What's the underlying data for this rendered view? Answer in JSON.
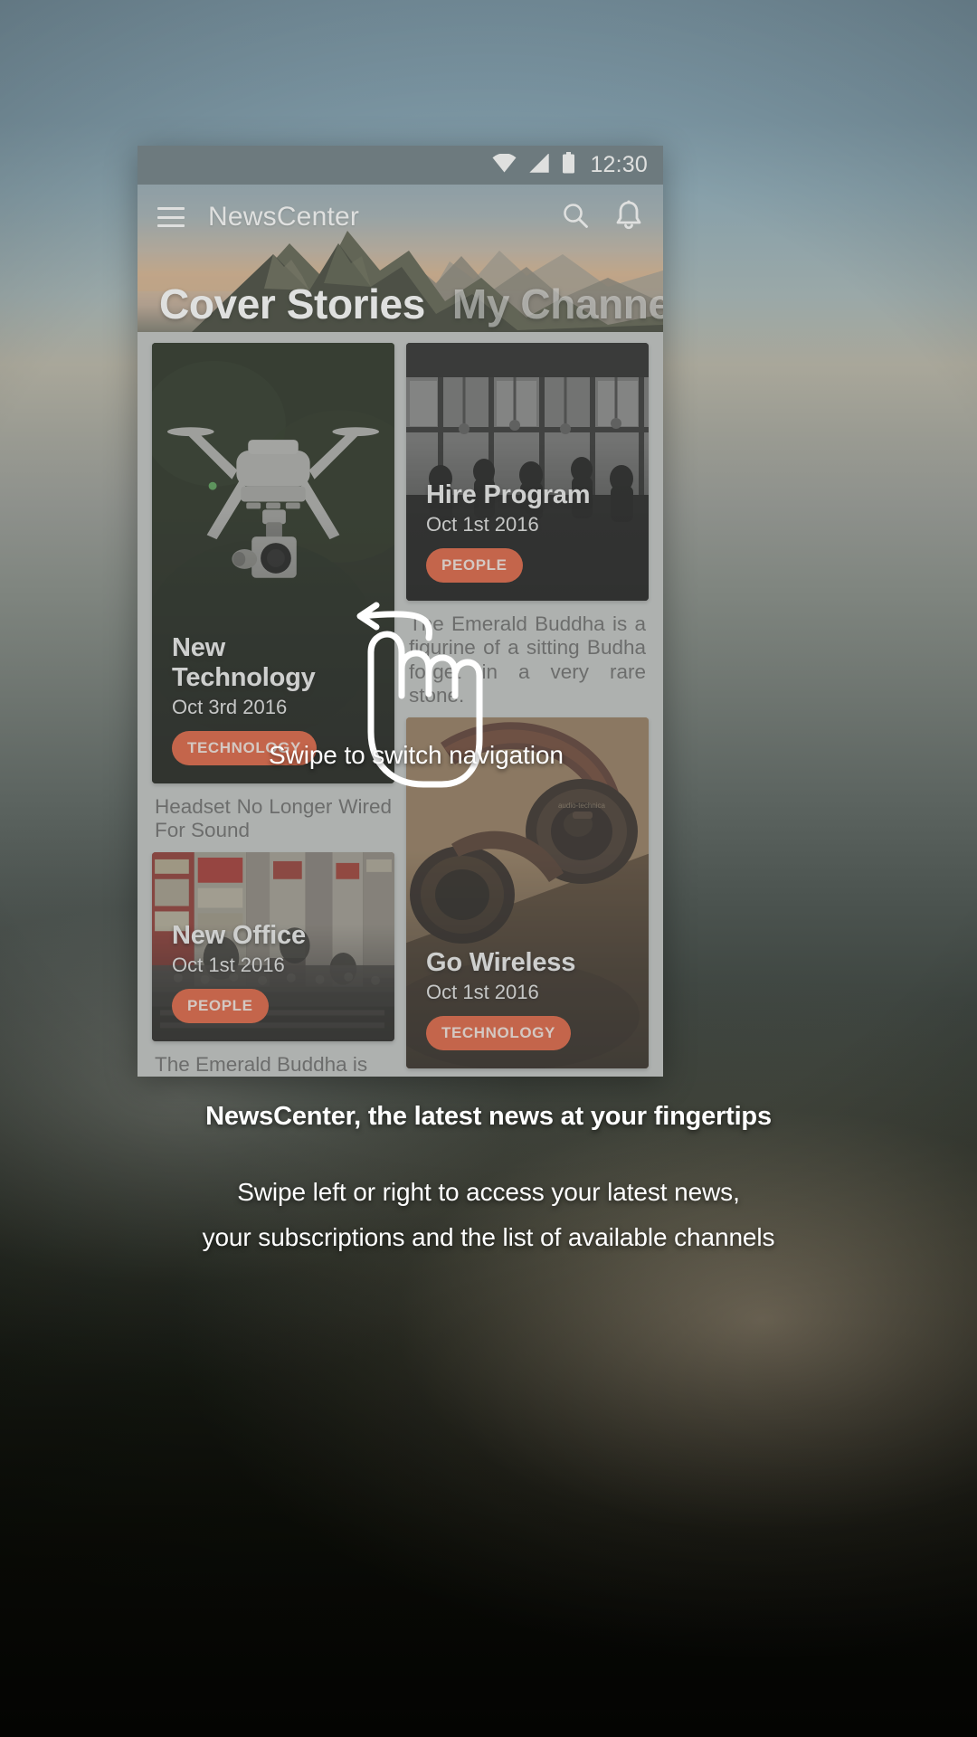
{
  "status_bar": {
    "time": "12:30",
    "icons": [
      "wifi-icon",
      "signal-icon",
      "battery-icon"
    ]
  },
  "app_bar": {
    "menu_icon": "hamburger-menu-icon",
    "title": "NewsCenter",
    "search_icon": "search-icon",
    "notifications_icon": "bell-icon"
  },
  "tabs": [
    {
      "label": "Cover Stories",
      "active": true
    },
    {
      "label": "My Channels",
      "active": false
    }
  ],
  "cards": {
    "new_technology": {
      "title": "New Technology",
      "date": "Oct 3rd 2016",
      "tag": "TECHNOLOGY"
    },
    "hire_program": {
      "title": "Hire Program",
      "date": "Oct 1st 2016",
      "tag": "PEOPLE"
    },
    "new_office": {
      "title": "New Office",
      "date": "Oct 1st 2016",
      "tag": "PEOPLE"
    },
    "go_wireless": {
      "title": "Go Wireless",
      "date": "Oct 1st 2016",
      "tag": "TECHNOLOGY"
    }
  },
  "excerpts": {
    "emerald_buddha": "The Emerald Buddha is a figurine of a sitting Budha forget in a very rare stone.",
    "headset": "Headset No Longer Wired For Sound",
    "emerald_buddha_partial": "The Emerald Buddha is"
  },
  "coach_mark": {
    "label": "Swipe to switch navigation",
    "gesture_icon": "swipe-hand-icon",
    "arrow_icon": "arrow-left-icon"
  },
  "caption": {
    "heading": "NewsCenter, the latest news at your fingertips",
    "line1": "Swipe left or right to access your latest news,",
    "line2": "your subscriptions and the list of available channels"
  },
  "colors": {
    "accent": "#d9502b",
    "status_bar": "#5c6d74",
    "content_bg": "#b9bcbb",
    "text_light": "#ffffff"
  }
}
